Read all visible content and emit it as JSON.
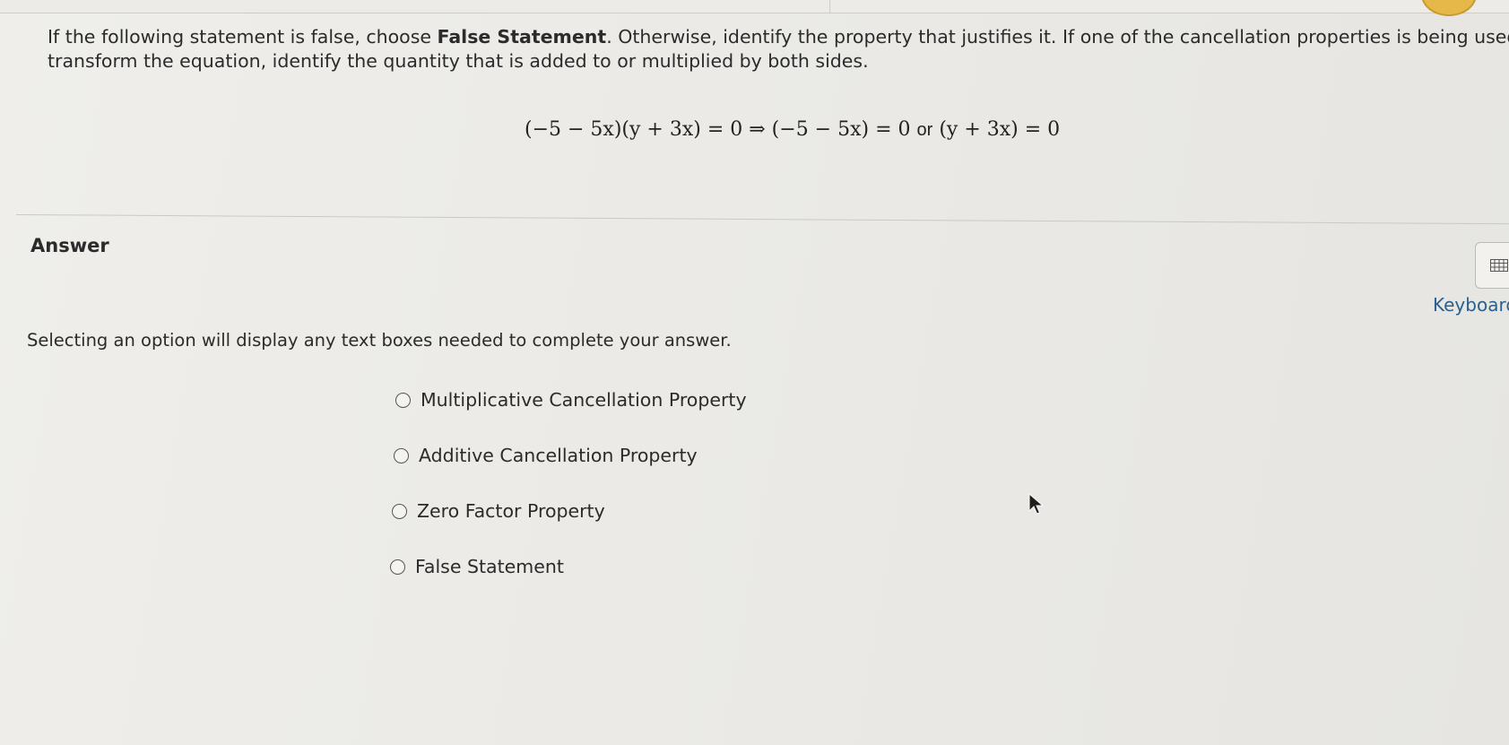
{
  "question": {
    "line1_prefix": "If the following statement is false, choose ",
    "line1_bold": "False Statement",
    "line1_suffix": ". Otherwise, identify the property that justifies it. If one of the cancellation properties is being used to",
    "line2": "transform the equation, identify the quantity that is added to or multiplied by both sides."
  },
  "equation": {
    "left": "(−5 − 5x)(y + 3x) = 0 ⇒ (−5 − 5x) = 0",
    "or_word": "or",
    "right": "(y + 3x) = 0"
  },
  "answer": {
    "heading": "Answer",
    "instruction": "Selecting an option will display any text boxes needed to complete your answer.",
    "options": [
      {
        "label": "Multiplicative Cancellation Property"
      },
      {
        "label": "Additive Cancellation Property"
      },
      {
        "label": "Zero Factor Property"
      },
      {
        "label": "False Statement"
      }
    ]
  },
  "keyboard": {
    "label": "Keyboard",
    "icon": "keyboard-icon"
  },
  "colors": {
    "background": "#ebeae6",
    "text": "#2b2b2b",
    "link": "#2a5f8e",
    "avatar": "#e6b84a"
  }
}
